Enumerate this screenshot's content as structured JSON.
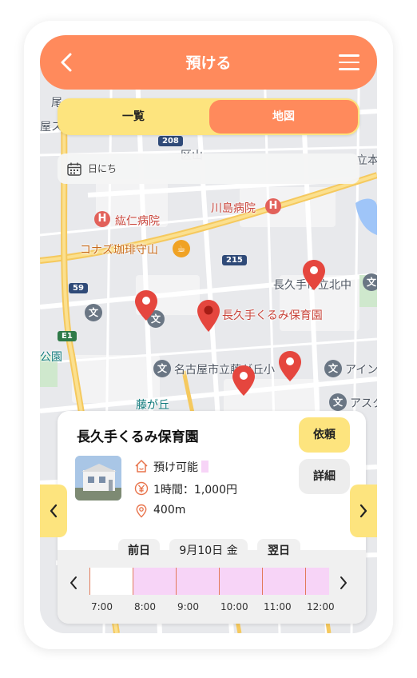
{
  "header": {
    "title": "預ける",
    "back_icon": "chevron-left-icon",
    "menu_icon": "hamburger-menu-icon",
    "color": "#ff8a5c"
  },
  "view_toggle": {
    "list_label": "一覧",
    "map_label": "地図",
    "selected": "地図",
    "accent": "#fde47e"
  },
  "date_filter": {
    "placeholder": "日にち",
    "icon": "calendar-icon"
  },
  "map": {
    "labels": {
      "hospital1": "紘仁病院",
      "hospital2": "川島病院",
      "cafe": "コナズ珈琲守山",
      "school1": "長久手市立北中",
      "selected_place": "長久手くるみ保育園",
      "school2": "名古屋市立藤が丘小",
      "misc1": "アイン",
      "misc2": "アスク",
      "station": "藤が丘",
      "park": "公園",
      "fragment1": "尾",
      "fragment2": "屋ス",
      "fragment3": "立本",
      "fragment4": "区山"
    },
    "route_badges": [
      "208",
      "215",
      "59",
      "E1"
    ]
  },
  "facility": {
    "name": "長久手くるみ保育園",
    "availability": "預け可能",
    "price": "1時間：1,000円",
    "distance": "400m",
    "request_label": "依頼",
    "detail_label": "詳細"
  },
  "schedule": {
    "prev_day": "前日",
    "current_day": "9月10日 金",
    "next_day": "翌日",
    "times": [
      "7:00",
      "8:00",
      "9:00",
      "10:00",
      "11:00",
      "12:00"
    ],
    "slot_status": [
      "free",
      "booked",
      "booked",
      "booked",
      "booked",
      "booked"
    ],
    "booked_color": "#f7d4f7"
  }
}
